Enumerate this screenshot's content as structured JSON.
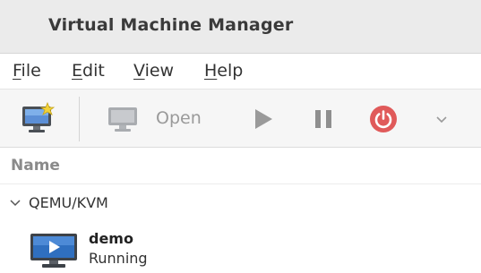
{
  "window": {
    "title": "Virtual Machine Manager"
  },
  "menubar": {
    "items": [
      {
        "mnemonic": "F",
        "rest": "ile"
      },
      {
        "mnemonic": "E",
        "rest": "dit"
      },
      {
        "mnemonic": "V",
        "rest": "iew"
      },
      {
        "mnemonic": "H",
        "rest": "elp"
      }
    ]
  },
  "toolbar": {
    "new_vm_icon": "new-vm-monitor-icon",
    "open_icon": "monitor-icon",
    "open_label": "Open",
    "run_icon": "play-icon",
    "pause_icon": "pause-icon",
    "shutdown_icon": "power-icon",
    "shutdown_menu_icon": "chevron-down-icon",
    "colors": {
      "shutdown": "#e05a5a",
      "disabled": "#9a9a9a"
    }
  },
  "list": {
    "column_name": "Name",
    "group": {
      "label": "QEMU/KVM",
      "expanded": true
    },
    "vms": [
      {
        "name": "demo",
        "status": "Running",
        "icon": "vm-running-monitor-icon"
      }
    ]
  }
}
